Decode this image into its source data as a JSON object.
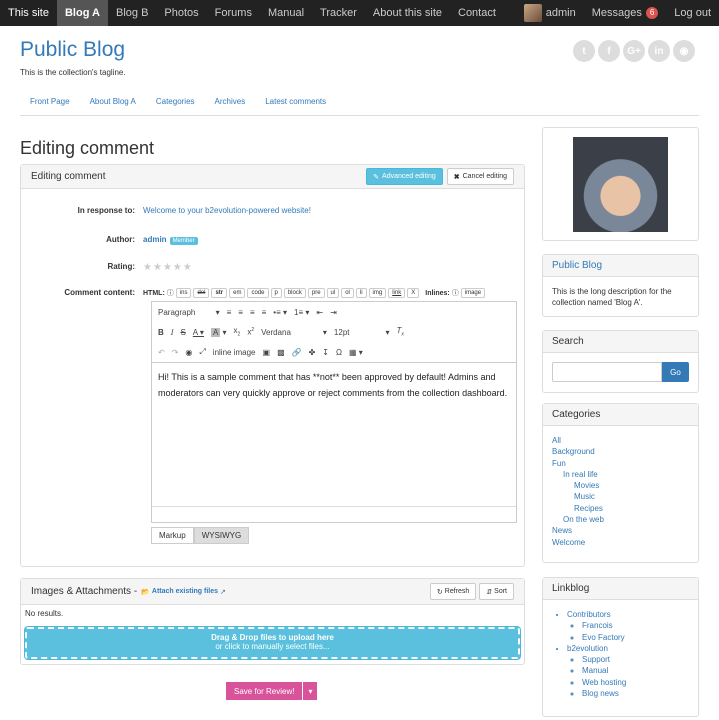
{
  "topnav": {
    "items": [
      "This site",
      "Blog A",
      "Blog B",
      "Photos",
      "Forums",
      "Manual",
      "Tracker",
      "About this site",
      "Contact"
    ],
    "user": "admin",
    "messages": "Messages",
    "messages_count": "6",
    "logout": "Log out"
  },
  "site": {
    "title": "Public Blog",
    "tagline": "This is the collection's tagline."
  },
  "menu": [
    "Front Page",
    "About Blog A",
    "Categories",
    "Archives",
    "Latest comments"
  ],
  "page_title": "Editing comment",
  "panel": {
    "title": "Editing comment",
    "advanced": "Advanced editing",
    "cancel": "Cancel editing"
  },
  "form": {
    "in_response_label": "In response to:",
    "in_response_value": "Welcome to your b2evolution-powered website!",
    "author_label": "Author:",
    "author_value": "admin",
    "author_badge": "Member",
    "rating_label": "Rating:",
    "content_label": "Comment content:",
    "html_label": "HTML:",
    "html_buttons": [
      "ins",
      "del",
      "str",
      "em",
      "code",
      "p",
      "block",
      "pre",
      "ul",
      "ol",
      "li",
      "img",
      "link",
      "X"
    ],
    "inlines_label": "Inlines:",
    "inlines_buttons": [
      "image"
    ]
  },
  "editor": {
    "paragraph": "Paragraph",
    "font": "Verdana",
    "size": "12pt",
    "inline_image": "inline image",
    "content": "Hi! This is a sample comment that has **not** been approved by default! Admins and moderators can very quickly approve or reject comments from the collection dashboard.",
    "tab_markup": "Markup",
    "tab_wysiwyg": "WYSIWYG"
  },
  "attachments": {
    "title": "Images & Attachments -",
    "attach_link": "Attach existing files",
    "refresh": "Refresh",
    "sort": "Sort",
    "no_results": "No results.",
    "drop_title": "Drag & Drop files to upload here",
    "drop_sub": "or click to manually select files..."
  },
  "save_button": "Save for Review!",
  "sidebar": {
    "blog_title": "Public Blog",
    "blog_desc": "This is the long description for the collection named 'Blog A'.",
    "search_title": "Search",
    "search_go": "Go",
    "categories_title": "Categories",
    "categories": [
      "All",
      "Background",
      "Fun",
      "In real life",
      "Movies",
      "Music",
      "Recipes",
      "On the web",
      "News",
      "Welcome"
    ],
    "linkblog_title": "Linkblog",
    "linkblog": {
      "contributors": "Contributors",
      "contributors_items": [
        "Francois",
        "Evo Factory"
      ],
      "b2evolution": "b2evolution",
      "b2evolution_items": [
        "Support",
        "Manual",
        "Web hosting",
        "Blog news"
      ]
    }
  }
}
